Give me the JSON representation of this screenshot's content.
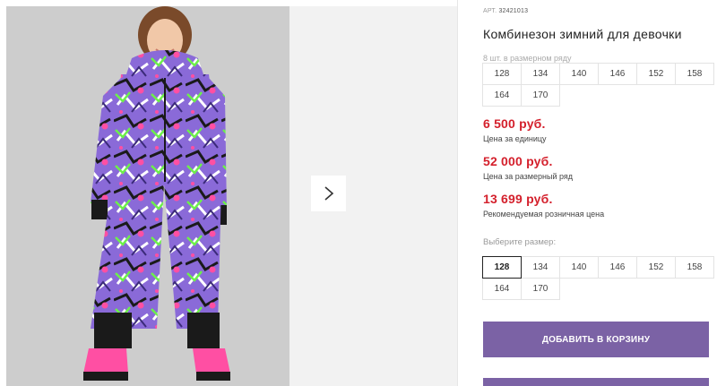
{
  "product": {
    "sku_label": "АРТ.",
    "sku_value": "32421013",
    "title": "Комбинезон зимний для девочки"
  },
  "pack": {
    "label": "8 шт. в размерном ряду",
    "sizes": [
      "128",
      "134",
      "140",
      "146",
      "152",
      "158",
      "164",
      "170"
    ]
  },
  "prices": {
    "unit_price": "6 500 руб.",
    "unit_label": "Цена за единицу",
    "pack_price": "52 000 руб.",
    "pack_label": "Цена за размерный ряд",
    "retail_price": "13 699 руб.",
    "retail_label": "Рекомендуемая розничная цена"
  },
  "size_picker": {
    "label": "Выберите размер:",
    "sizes": [
      "128",
      "134",
      "140",
      "146",
      "152",
      "158",
      "164",
      "170"
    ],
    "selected": "128"
  },
  "actions": {
    "add_to_cart": "ДОБАВИТЬ В КОРЗИНУ"
  },
  "colors": {
    "price_red": "#d4202c",
    "button_purple": "#7b62a5"
  },
  "icons": {
    "next": "chevron-right-icon"
  }
}
